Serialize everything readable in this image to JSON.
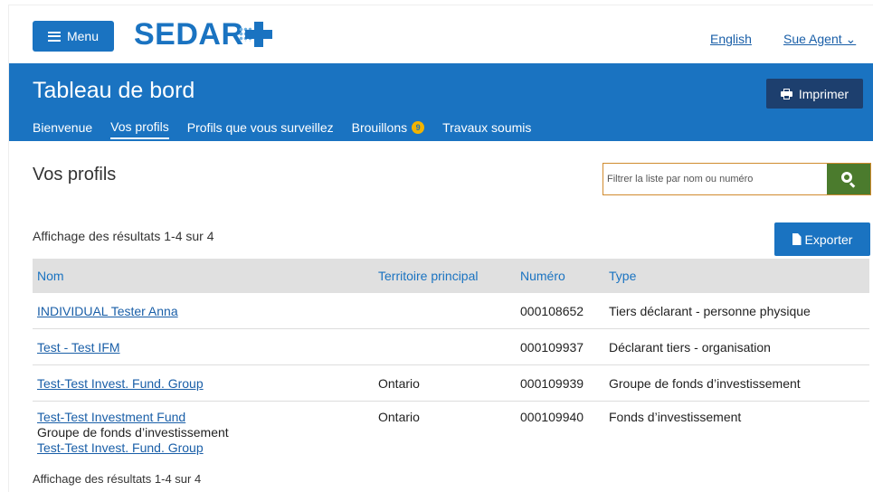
{
  "topbar": {
    "menu_label": "Menu",
    "logo_text": "SEDAR",
    "language_link": "English",
    "user_link": "Sue Agent ⌄"
  },
  "header": {
    "title": "Tableau de bord",
    "print_label": "Imprimer",
    "tabs": [
      {
        "label": "Bienvenue"
      },
      {
        "label": "Vos profils"
      },
      {
        "label": "Profils que vous surveillez"
      },
      {
        "label": "Brouillons",
        "badge": "9"
      },
      {
        "label": "Travaux soumis"
      }
    ]
  },
  "main": {
    "section_title": "Vos profils",
    "search_placeholder": "Filtrer la liste par nom ou numéro",
    "results_top": "Affichage des résultats 1-4 sur 4",
    "export_label": "Exporter",
    "results_bottom": "Affichage des résultats 1-4 sur 4"
  },
  "table": {
    "headers": [
      "Nom",
      "Territoire principal",
      "Numéro",
      "Type"
    ],
    "rows": [
      {
        "name": "INDIVIDUAL Tester Anna",
        "territory": "",
        "number": "000108652",
        "type": "Tiers déclarant - personne physique"
      },
      {
        "name": "Test - Test IFM",
        "territory": "",
        "number": "000109937",
        "type": "Déclarant tiers - organisation"
      },
      {
        "name": "Test-Test Invest. Fund. Group",
        "territory": "Ontario",
        "number": "000109939",
        "type": "Groupe de fonds d’investissement"
      },
      {
        "name": "Test-Test Investment Fund",
        "sub_label": "Groupe de fonds d’investissement",
        "sub_link": "Test-Test Invest. Fund. Group",
        "territory": "Ontario",
        "number": "000109940",
        "type": "Fonds d’investissement"
      }
    ]
  },
  "colors": {
    "brand_blue": "#1a73c1",
    "print_button": "#1d3f6e",
    "search_button": "#4b7b2d",
    "badge": "#f2b300"
  }
}
